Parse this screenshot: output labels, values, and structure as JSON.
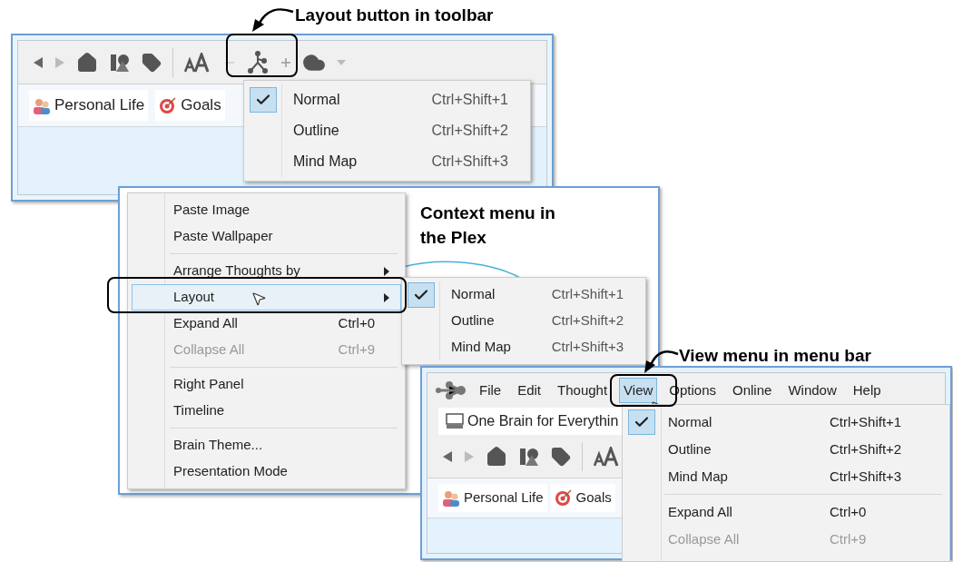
{
  "callouts": [
    {
      "text": "Layout button in toolbar"
    },
    {
      "text": "Context menu in the Plex"
    },
    {
      "text": "View menu in menu bar"
    }
  ],
  "toolbar_window": {
    "tabs": [
      {
        "label": "Personal Life",
        "kind": "person"
      },
      {
        "label": "Goals",
        "kind": "target"
      }
    ],
    "layout_menu": [
      {
        "label": "Normal",
        "shortcut": "Ctrl+Shift+1",
        "checked": true
      },
      {
        "label": "Outline",
        "shortcut": "Ctrl+Shift+2",
        "checked": false
      },
      {
        "label": "Mind Map",
        "shortcut": "Ctrl+Shift+3",
        "checked": false
      }
    ]
  },
  "context_window": {
    "menu": [
      {
        "kind": "item",
        "label": "Paste Image",
        "disabled": false,
        "selected": false
      },
      {
        "kind": "item",
        "label": "Paste Wallpaper",
        "disabled": false,
        "selected": false
      },
      {
        "kind": "separator"
      },
      {
        "kind": "submenu",
        "label": "Arrange Thoughts by",
        "disabled": false,
        "selected": false
      },
      {
        "kind": "submenu",
        "label": "Layout",
        "disabled": false,
        "selected": true
      },
      {
        "kind": "item",
        "label": "Expand All",
        "shortcut": "Ctrl+0",
        "disabled": false,
        "selected": false
      },
      {
        "kind": "item",
        "label": "Collapse All",
        "shortcut": "Ctrl+9",
        "disabled": true,
        "selected": false
      },
      {
        "kind": "separator"
      },
      {
        "kind": "item",
        "label": "Right Panel",
        "disabled": false,
        "selected": false
      },
      {
        "kind": "item",
        "label": "Timeline",
        "disabled": false,
        "selected": false
      },
      {
        "kind": "separator"
      },
      {
        "kind": "item",
        "label": "Brain Theme...",
        "disabled": false,
        "selected": false
      },
      {
        "kind": "item",
        "label": "Presentation Mode",
        "disabled": false,
        "selected": false
      }
    ],
    "submenu": [
      {
        "label": "Normal",
        "shortcut": "Ctrl+Shift+1",
        "checked": true
      },
      {
        "label": "Outline",
        "shortcut": "Ctrl+Shift+2",
        "checked": false
      },
      {
        "label": "Mind Map",
        "shortcut": "Ctrl+Shift+3",
        "checked": false
      }
    ]
  },
  "menubar_window": {
    "menus": [
      {
        "label": "File",
        "selected": false
      },
      {
        "label": "Edit",
        "selected": false
      },
      {
        "label": "Thought",
        "selected": false
      },
      {
        "label": "View",
        "selected": true
      },
      {
        "label": "Options",
        "selected": false
      },
      {
        "label": "Online",
        "selected": false
      },
      {
        "label": "Window",
        "selected": false
      },
      {
        "label": "Help",
        "selected": false
      }
    ],
    "brain_tab": "One Brain for Everythin",
    "tabs": [
      {
        "label": "Personal Life",
        "kind": "person"
      },
      {
        "label": "Goals",
        "kind": "target"
      }
    ],
    "view_menu": [
      {
        "kind": "item",
        "label": "Normal",
        "shortcut": "Ctrl+Shift+1",
        "checked": true,
        "disabled": false
      },
      {
        "kind": "item",
        "label": "Outline",
        "shortcut": "Ctrl+Shift+2",
        "checked": false,
        "disabled": false
      },
      {
        "kind": "item",
        "label": "Mind Map",
        "shortcut": "Ctrl+Shift+3",
        "checked": false,
        "disabled": false
      },
      {
        "kind": "separator"
      },
      {
        "kind": "item",
        "label": "Expand All",
        "shortcut": "Ctrl+0",
        "checked": false,
        "disabled": false
      },
      {
        "kind": "item",
        "label": "Collapse All",
        "shortcut": "Ctrl+9",
        "checked": false,
        "disabled": true
      }
    ]
  }
}
